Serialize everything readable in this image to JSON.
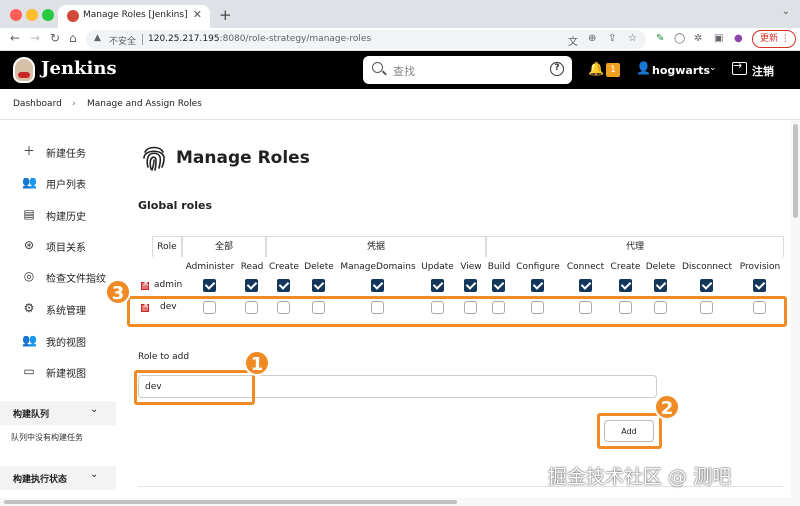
{
  "browser": {
    "tab_title": "Manage Roles [Jenkins]",
    "insecure_label": "不安全",
    "url_host": "120.25.217.195",
    "url_path": ":8080/role-strategy/manage-roles",
    "update_label": "更新",
    "colors": {
      "close": "#ff5f57",
      "minimize": "#febc2e",
      "maximize": "#28c840"
    }
  },
  "header": {
    "brand": "Jenkins",
    "search_placeholder": "查找",
    "help_glyph": "?",
    "notification_count": "1",
    "username": "hogwarts",
    "logout_label": "注销",
    "colors": {
      "background": "#000000",
      "badge": "#f0a020"
    }
  },
  "breadcrumb": {
    "items": [
      "Dashboard",
      "Manage and Assign Roles"
    ],
    "separator": "›"
  },
  "sidebar": {
    "items": [
      {
        "icon": "plus-icon",
        "label": "新建任务"
      },
      {
        "icon": "users-icon",
        "label": "用户列表"
      },
      {
        "icon": "history-icon",
        "label": "构建历史"
      },
      {
        "icon": "relationship-icon",
        "label": "项目关系"
      },
      {
        "icon": "fingerprint-icon",
        "label": "检查文件指纹"
      },
      {
        "icon": "gear-icon",
        "label": "系统管理"
      },
      {
        "icon": "people-icon",
        "label": "我的视图"
      },
      {
        "icon": "folder-icon",
        "label": "新建视图"
      }
    ],
    "build_queue": {
      "title": "构建队列",
      "empty_text": "队列中没有构建任务"
    },
    "executor_status": {
      "title": "构建执行状态"
    }
  },
  "main": {
    "title": "Manage Roles",
    "section_title": "Global roles",
    "table": {
      "role_header": "Role",
      "groups": [
        "全部",
        "凭据",
        "代理"
      ],
      "columns": [
        "Administer",
        "Read",
        "Create",
        "Delete",
        "ManageDomains",
        "Update",
        "View",
        "Build",
        "Configure",
        "Connect",
        "Create",
        "Delete",
        "Disconnect",
        "Provision"
      ],
      "rows": [
        {
          "name": "admin",
          "checked": [
            true,
            true,
            true,
            true,
            true,
            true,
            true,
            true,
            true,
            true,
            true,
            true,
            true,
            true
          ]
        },
        {
          "name": "dev",
          "checked": [
            false,
            false,
            false,
            false,
            false,
            false,
            false,
            false,
            false,
            false,
            false,
            false,
            false,
            false
          ]
        }
      ]
    },
    "role_to_add": {
      "label": "Role to add",
      "value": "dev"
    },
    "add_button": "Add",
    "annotations": [
      "1",
      "2",
      "3"
    ],
    "annotation_color": "#f08a24",
    "checkbox_color": "#14365a"
  },
  "watermark": "掘金技术社区 @ 测吧"
}
